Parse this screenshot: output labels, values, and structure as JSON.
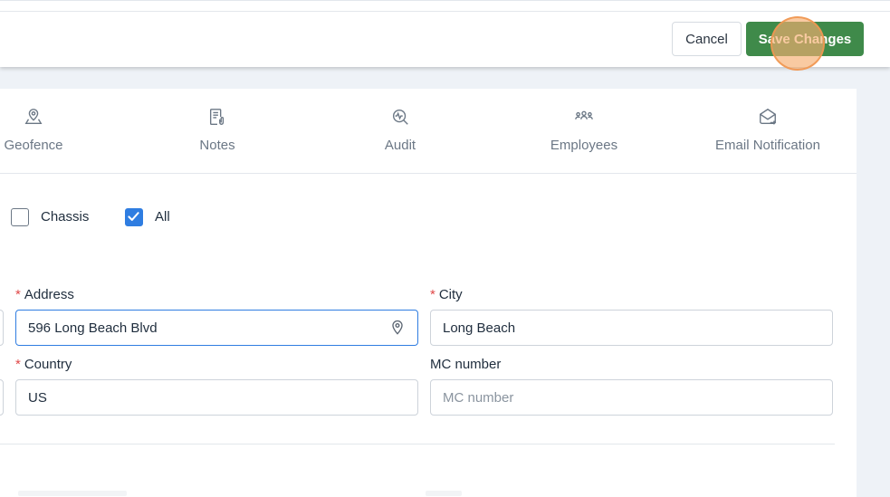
{
  "header": {
    "cancel_label": "Cancel",
    "save_label": "Save Changes"
  },
  "tabs": [
    {
      "label": "Geofence",
      "icon": "geofence-icon"
    },
    {
      "label": "Notes",
      "icon": "notes-icon"
    },
    {
      "label": "Audit",
      "icon": "audit-icon"
    },
    {
      "label": "Employees",
      "icon": "employees-icon"
    },
    {
      "label": "Email Notification",
      "icon": "email-notification-icon"
    }
  ],
  "equipment_types": [
    {
      "label": "Chassis",
      "checked": false
    },
    {
      "label": "All",
      "checked": true
    }
  ],
  "form": {
    "address": {
      "label": "Address",
      "required": true,
      "value": "596 Long Beach Blvd"
    },
    "city": {
      "label": "City",
      "required": true,
      "value": "Long Beach"
    },
    "country": {
      "label": "Country",
      "required": true,
      "value": "US"
    },
    "mc_number": {
      "label": "MC number",
      "required": false,
      "value": "",
      "placeholder": "MC number"
    }
  },
  "colors": {
    "accent": "#2f7de1",
    "save_button": "#3f8a4a",
    "required_marker": "#e04848"
  }
}
